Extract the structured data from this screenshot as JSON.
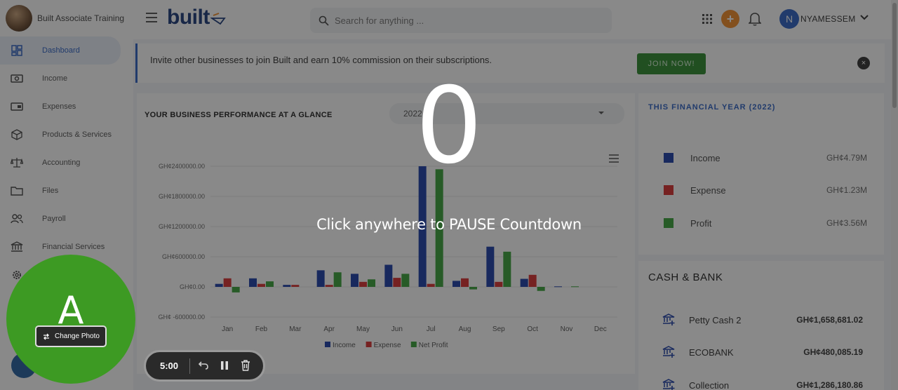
{
  "brand": {
    "name": "Built Associate Training"
  },
  "sidebar": {
    "items": [
      {
        "label": "Dashboard",
        "icon": "dashboard-icon",
        "active": true
      },
      {
        "label": "Income",
        "icon": "cash-icon"
      },
      {
        "label": "Expenses",
        "icon": "wallet-icon"
      },
      {
        "label": "Products & Services",
        "icon": "box-icon"
      },
      {
        "label": "Accounting",
        "icon": "scale-icon"
      },
      {
        "label": "Files",
        "icon": "folder-icon"
      },
      {
        "label": "Payroll",
        "icon": "people-icon"
      },
      {
        "label": "Financial Services",
        "icon": "bank-icon"
      },
      {
        "label": "",
        "icon": "gear-icon"
      }
    ]
  },
  "header": {
    "logo": "built",
    "search_placeholder": "Search for anything ...",
    "user_initial": "N",
    "user_name": "NYAMESSEM",
    "plus_label": "+"
  },
  "banner": {
    "text": "Invite other businesses to join Built and earn 10% commission on their subscriptions.",
    "button": "JOIN NOW!",
    "close": "×"
  },
  "chart_card": {
    "title": "YOUR BUSINESS PERFORMANCE AT A GLANCE",
    "year_value": "2022"
  },
  "chart_data": {
    "type": "bar",
    "categories": [
      "Jan",
      "Feb",
      "Mar",
      "Apr",
      "May",
      "Jun",
      "Jul",
      "Aug",
      "Sep",
      "Oct",
      "Nov",
      "Dec"
    ],
    "series": [
      {
        "name": "Income",
        "color": "#1d3fa8",
        "values": [
          60000,
          170000,
          40000,
          330000,
          260000,
          440000,
          2400000,
          120000,
          800000,
          160000,
          10000,
          0
        ]
      },
      {
        "name": "Expense",
        "color": "#d93030",
        "values": [
          170000,
          60000,
          40000,
          40000,
          100000,
          180000,
          60000,
          170000,
          100000,
          240000,
          0,
          0
        ]
      },
      {
        "name": "Net Profit",
        "color": "#3aa33a",
        "values": [
          -110000,
          110000,
          0,
          290000,
          150000,
          260000,
          2340000,
          -50000,
          700000,
          -80000,
          10000,
          0
        ]
      }
    ],
    "y_ticks": [
      "GH¢2400000.00",
      "GH¢1800000.00",
      "GH¢1200000.00",
      "GH¢600000.00",
      "GH¢0.00",
      "GH¢ -600000.00"
    ],
    "ylim": [
      -600000,
      2400000
    ],
    "legend_position": "bottom"
  },
  "financial_year": {
    "title": "THIS FINANCIAL YEAR (2022)",
    "rows": [
      {
        "label": "Income",
        "value": "GH¢4.79M",
        "color": "#1d3fa8"
      },
      {
        "label": "Expense",
        "value": "GH¢1.23M",
        "color": "#d93030"
      },
      {
        "label": "Profit",
        "value": "GH¢3.56M",
        "color": "#3aa33a"
      }
    ]
  },
  "cash_bank": {
    "title": "CASH & BANK",
    "rows": [
      {
        "label": "Petty Cash 2",
        "value": "GH¢1,658,681.02"
      },
      {
        "label": "ECOBANK",
        "value": "GH¢480,085.19"
      },
      {
        "label": "Collection",
        "value": "GH¢1,286,180.86"
      }
    ]
  },
  "overlay": {
    "countdown": "0",
    "message": "Click anywhere to PAUSE Countdown"
  },
  "webcam": {
    "letter": "A",
    "change_photo": "Change Photo",
    "color": "#3d9a23"
  },
  "recorder": {
    "time": "5:00"
  }
}
